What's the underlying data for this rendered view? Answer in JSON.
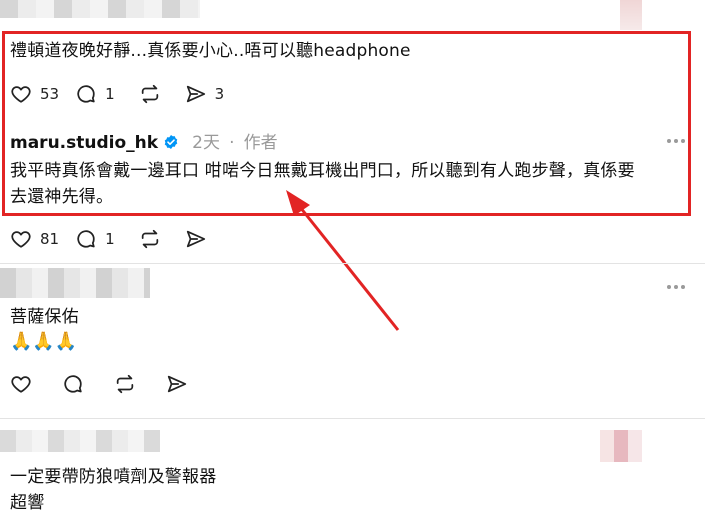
{
  "thread": {
    "quoted_reply": {
      "text": "禮頓道夜晚好靜...真係要小心..唔可以聽headphone",
      "likes": "53",
      "comments": "1",
      "shares": "3"
    },
    "author_reply": {
      "username": "maru.studio_hk",
      "verified": true,
      "time": "2天",
      "separator": "·",
      "role": "作者",
      "text_line1": "我平時真係會戴一邊耳口 咁啱今日無戴耳機出門口，所以聽到有人跑步聲，真係要",
      "text_line2": "去還神先得。",
      "likes": "81",
      "comments": "1"
    },
    "comment_1": {
      "text": "菩薩保佑",
      "emoji": "🙏🙏🙏"
    },
    "comment_2": {
      "line1": "一定要帶防狼噴劑及警報器",
      "line2": "超響"
    }
  },
  "colors": {
    "highlight_border": "#e22424",
    "arrow": "#e22424",
    "verified_badge": "#0095f6",
    "muted_text": "#9a9a9a"
  },
  "icons": [
    "heart-icon",
    "comment-icon",
    "repost-icon",
    "share-icon",
    "more-icon",
    "verified-icon",
    "arrow-annotation"
  ]
}
